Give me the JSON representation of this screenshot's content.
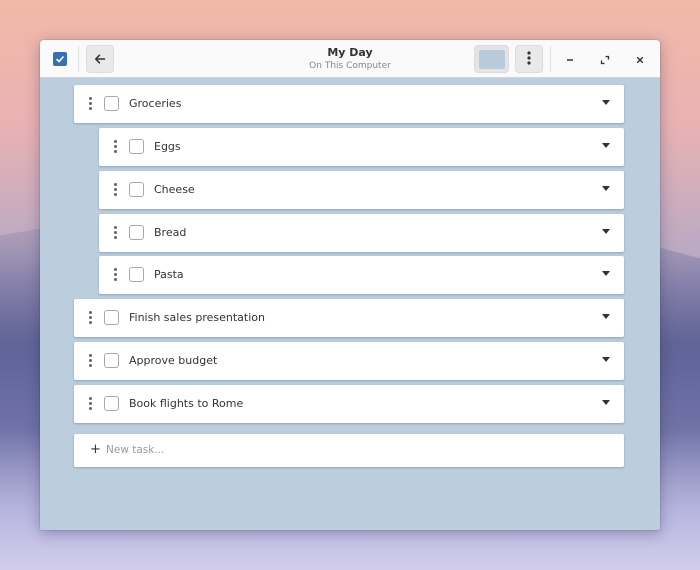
{
  "window": {
    "title": "My Day",
    "subtitle": "On This Computer",
    "accent": "#3a6fb3",
    "panel_bg": "#bccedd"
  },
  "toolbar": {
    "app_icon": "checkbox-icon",
    "back_icon": "arrow-left-icon",
    "view_icon": "color-swatch-icon",
    "menu_icon": "vertical-dots-icon",
    "minimize_icon": "minimize-icon",
    "maximize_icon": "maximize-icon",
    "close_icon": "close-icon"
  },
  "tasks": [
    {
      "label": "Groceries",
      "done": false,
      "subtask": false
    },
    {
      "label": "Eggs",
      "done": false,
      "subtask": true
    },
    {
      "label": "Cheese",
      "done": false,
      "subtask": true
    },
    {
      "label": "Bread",
      "done": false,
      "subtask": true
    },
    {
      "label": "Pasta",
      "done": false,
      "subtask": true
    },
    {
      "label": "Finish sales presentation",
      "done": false,
      "subtask": false
    },
    {
      "label": "Approve budget",
      "done": false,
      "subtask": false
    },
    {
      "label": "Book flights to Rome",
      "done": false,
      "subtask": false
    }
  ],
  "new_task": {
    "plus": "+",
    "placeholder": "New task..."
  }
}
